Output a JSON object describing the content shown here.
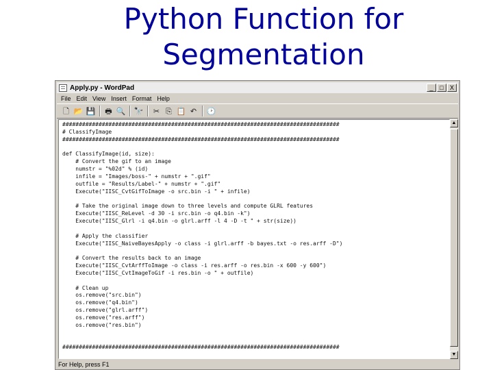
{
  "slide": {
    "title_line1": "Python Function for",
    "title_line2": "Segmentation"
  },
  "window": {
    "title": "Apply.py - WordPad",
    "controls": [
      "_",
      "□",
      "X"
    ]
  },
  "menu": [
    "File",
    "Edit",
    "View",
    "Insert",
    "Format",
    "Help"
  ],
  "toolbar_icons": [
    "new-icon",
    "open-icon",
    "save-icon",
    "print-icon",
    "print-preview-icon",
    "find-icon",
    "cut-icon",
    "copy-icon",
    "paste-icon",
    "undo-icon",
    "date-time-icon"
  ],
  "toolbar_glyphs": [
    "🗋",
    "📂",
    "💾",
    "🖶",
    "🔍",
    "🔭",
    "✂",
    "⎘",
    "📋",
    "↶",
    "🕑"
  ],
  "code": [
    "####################################################################################",
    "# ClassifyImage",
    "####################################################################################",
    "",
    "def ClassifyImage(id, size):",
    "    # Convert the gif to an image",
    "    numstr = \"%02d\" % (id)",
    "    infile = \"Images/boss-\" + numstr + \".gif\"",
    "    outfile = \"Results/Label-\" + numstr + \".gif\"",
    "    Execute(\"IISC_CvtGifToImage -o src.bin -i \" + infile)",
    "",
    "    # Take the original image down to three levels and compute GLRL features",
    "    Execute(\"IISC_ReLevel -d 30 -i src.bin -o q4.bin -k\")",
    "    Execute(\"IISC_Glrl -i q4.bin -o glrl.arff -l 4 -D -t \" + str(size))",
    "",
    "    # Apply the classifier",
    "    Execute(\"IISC_NaiveBayesApply -o class -i glrl.arff -b bayes.txt -o res.arff -D\")",
    "",
    "    # Convert the results back to an image",
    "    Execute(\"IISC_CvtArffToImage -o class -i res.arff -o res.bin -x 600 -y 600\")",
    "    Execute(\"IISC_CvtImageToGif -i res.bin -o \" + outfile)",
    "",
    "    # Clean up",
    "    os.remove(\"src.bin\")",
    "    os.remove(\"q4.bin\")",
    "    os.remove(\"glrl.arff\")",
    "    os.remove(\"res.arff\")",
    "    os.remove(\"res.bin\")",
    "",
    "",
    "####################################################################################"
  ],
  "statusbar": "For Help, press F1"
}
